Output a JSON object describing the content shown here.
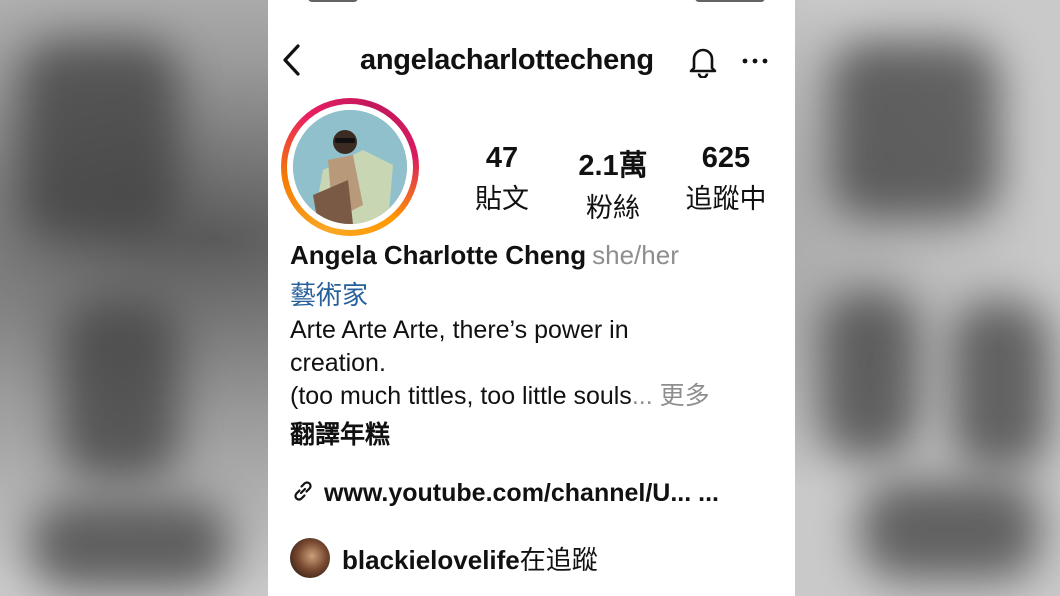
{
  "header": {
    "username": "angelacharlottecheng"
  },
  "stats": [
    {
      "value": "47",
      "label": "貼文"
    },
    {
      "value": "2.1萬",
      "label": "粉絲"
    },
    {
      "value": "625",
      "label": "追蹤中"
    }
  ],
  "bio": {
    "name": "Angela Charlotte Cheng",
    "pronouns": "she/her",
    "category": "藝術家",
    "line1": "Arte Arte Arte, there’s power in",
    "line2": "creation.",
    "line3": "(too much tittles, too little souls",
    "ellipsis": "...",
    "more": "更多",
    "translate": "翻譯年糕"
  },
  "link": {
    "text": "www.youtube.com/channel/U... ..."
  },
  "followed_by": {
    "user": "blackielovelife",
    "suffix": "在追蹤"
  },
  "icons": [
    "back-arrow-icon",
    "bell-icon",
    "more-dots-icon",
    "link-icon"
  ]
}
